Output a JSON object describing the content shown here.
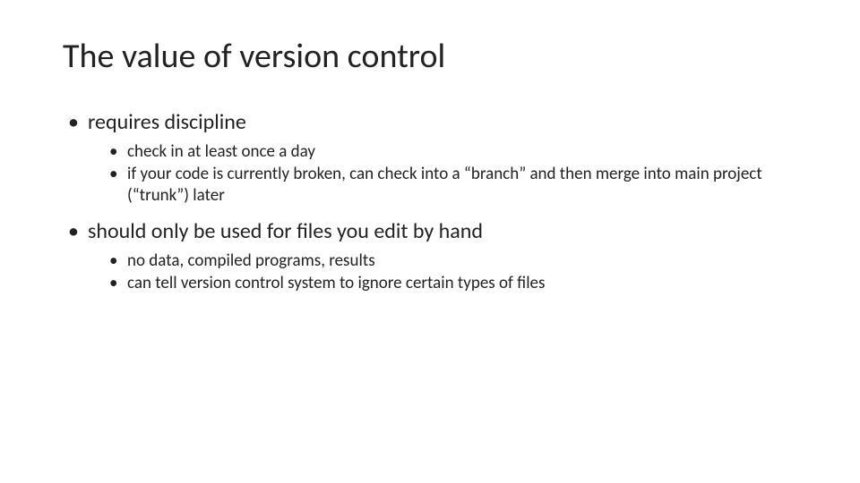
{
  "title": "The value of version control",
  "items": [
    {
      "text": "requires discipline",
      "sub": [
        "check in at least once a day",
        "if your code is currently broken, can check into a “branch” and then merge into main project (“trunk”) later"
      ]
    },
    {
      "text": "should only be used for files you edit by hand",
      "sub": [
        "no data, compiled programs, results",
        "can tell version control system to ignore certain types of files"
      ]
    }
  ]
}
